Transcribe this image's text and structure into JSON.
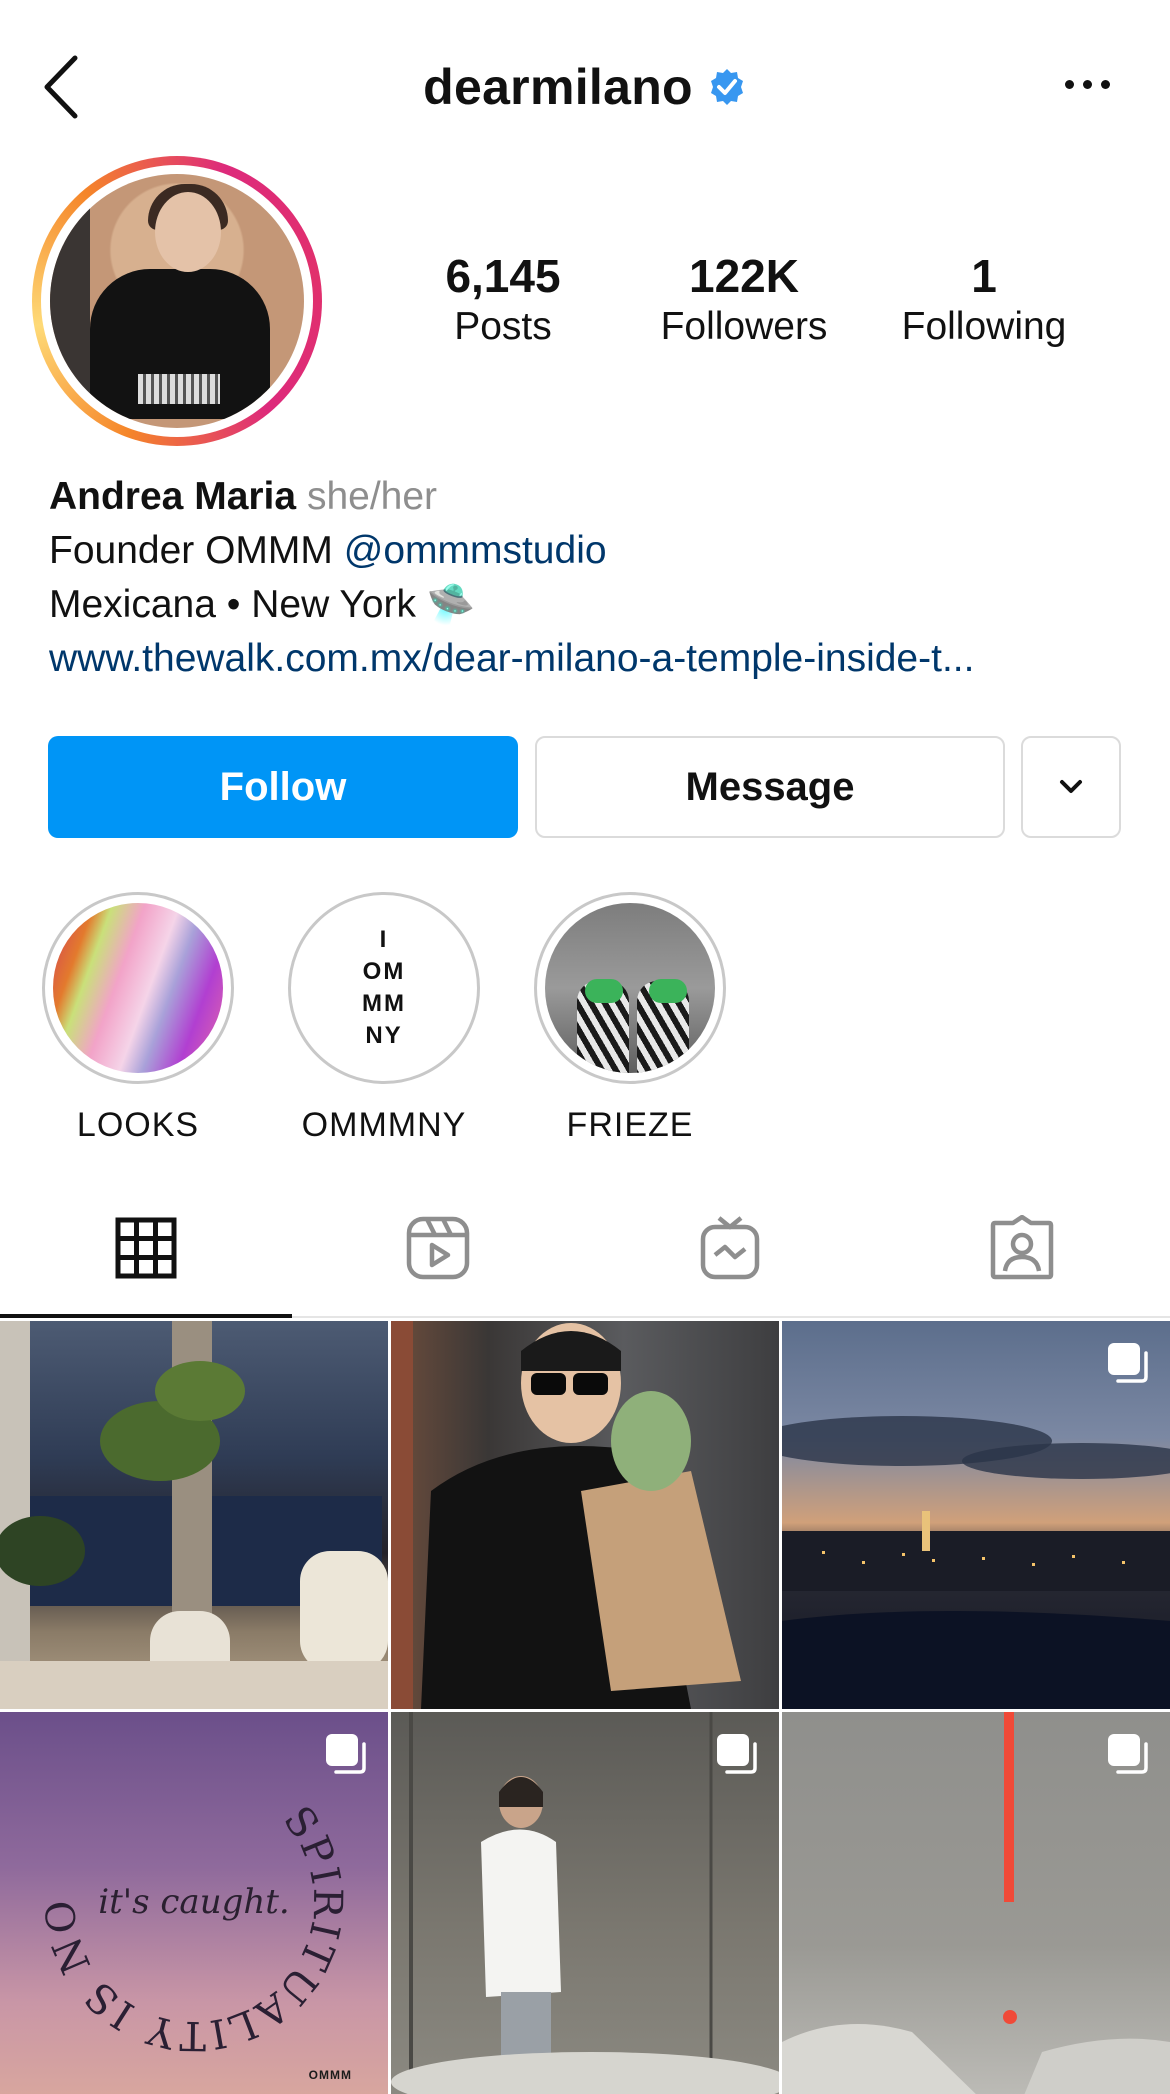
{
  "header": {
    "username": "dearmilano",
    "verified": true
  },
  "profile": {
    "stats": [
      {
        "value": "6,145",
        "label": "Posts"
      },
      {
        "value": "122K",
        "label": "Followers"
      },
      {
        "value": "1",
        "label": "Following"
      }
    ],
    "name": "Andrea Maria",
    "pronouns": "she/her",
    "bio_line1_prefix": "Founder OMMM ",
    "bio_line1_mention": "@ommmstudio",
    "bio_line2": "Mexicana • New York 🛸",
    "link": "www.thewalk.com.mx/dear-milano-a-temple-inside-t..."
  },
  "actions": {
    "follow": "Follow",
    "message": "Message"
  },
  "highlights": [
    {
      "label": "LOOKS"
    },
    {
      "label": "OMMMNY",
      "cover_text": [
        "I",
        "OM",
        "MM",
        "NY"
      ]
    },
    {
      "label": "FRIEZE"
    }
  ],
  "grid": {
    "quote_ring_text": "SPIRITUALITY IS NOT TAUGHT.",
    "quote_center": "it's caught.",
    "quote_brand": "OMMM"
  },
  "colors": {
    "accent": "#0095f6",
    "verified": "#3897f0",
    "link": "#00376b"
  }
}
